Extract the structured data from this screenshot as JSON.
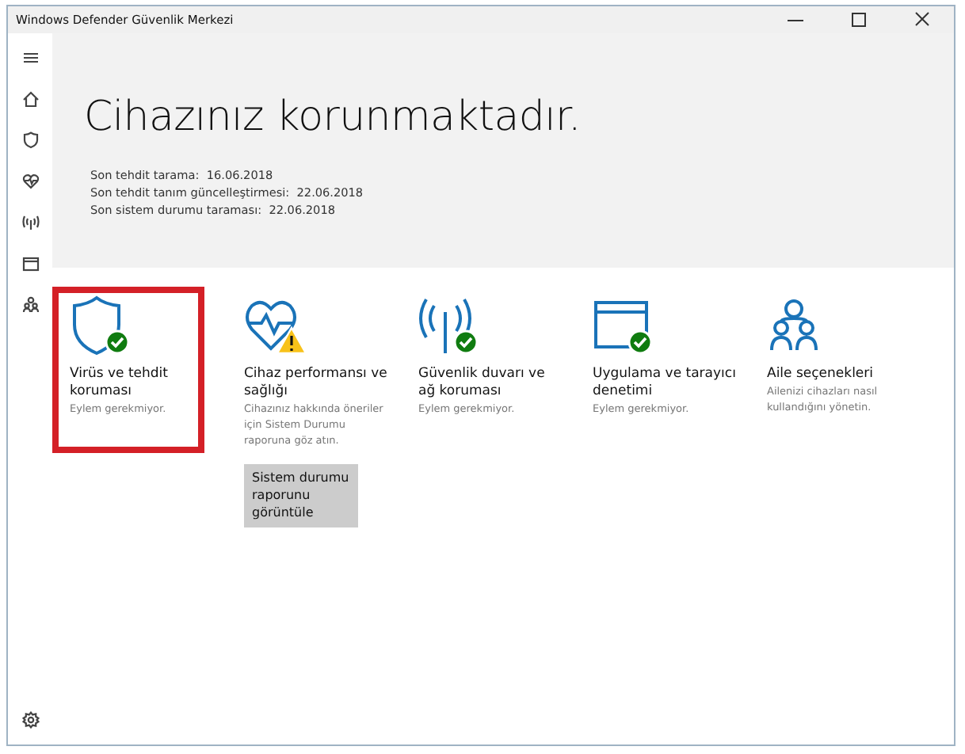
{
  "window": {
    "title": "Windows Defender Güvenlik Merkezi"
  },
  "hero": {
    "title": "Cihazınız korunmaktadır.",
    "scans": [
      {
        "label": "Son tehdit tarama:",
        "value": "16.06.2018"
      },
      {
        "label": "Son tehdit tanım güncelleştirmesi:",
        "value": "22.06.2018"
      },
      {
        "label": "Son sistem durumu taraması:",
        "value": "22.06.2018"
      }
    ]
  },
  "tiles": [
    {
      "icon": {
        "kind": "shield"
      },
      "badge": {
        "kind": "check"
      },
      "highlighted": true,
      "title": "Virüs ve tehdit koruması",
      "description": "Eylem gerekmiyor."
    },
    {
      "icon": {
        "kind": "health"
      },
      "badge": {
        "kind": "warning"
      },
      "highlighted": false,
      "title": "Cihaz performansı ve sağlığı",
      "description": "Cihazınız hakkında öneriler için Sistem Durumu raporuna göz atın.",
      "button": "Sistem durumu raporunu görüntüle"
    },
    {
      "icon": {
        "kind": "network"
      },
      "badge": {
        "kind": "check"
      },
      "highlighted": false,
      "title": "Güvenlik duvarı ve ağ koruması",
      "description": "Eylem gerekmiyor."
    },
    {
      "icon": {
        "kind": "browser"
      },
      "badge": {
        "kind": "check"
      },
      "highlighted": false,
      "title": "Uygulama ve tarayıcı denetimi",
      "description": "Eylem gerekmiyor."
    },
    {
      "icon": {
        "kind": "family"
      },
      "highlighted": false,
      "title": "Aile seçenekleri",
      "description": "Ailenizi cihazları nasıl kullandığını yönetin."
    }
  ]
}
